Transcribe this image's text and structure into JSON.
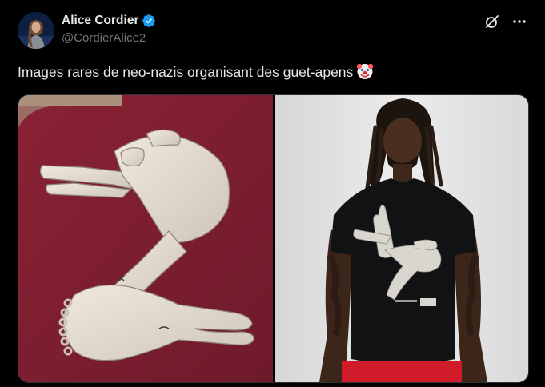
{
  "author": {
    "display_name": "Alice Cordier",
    "handle": "@CordierAlice2",
    "verified": true,
    "avatar_icon": "profile-photo"
  },
  "actions": {
    "grok_icon": "grok-icon",
    "more_icon": "more-icon"
  },
  "tweet": {
    "text": "Images rares de neo-nazis organisant des guet-apens",
    "emoji": "clown-face-emoji"
  },
  "media": {
    "count": 2,
    "images": [
      "hand-gesture-illustration",
      "man-in-printed-tshirt-photo"
    ]
  },
  "colors": {
    "background": "#000000",
    "text": "#e7e9ea",
    "secondary_text": "#71767b",
    "verified_badge": "#1d9bf0",
    "media_left_bg": "#7a1d2e",
    "media_right_bg": "#e3e3e3"
  }
}
